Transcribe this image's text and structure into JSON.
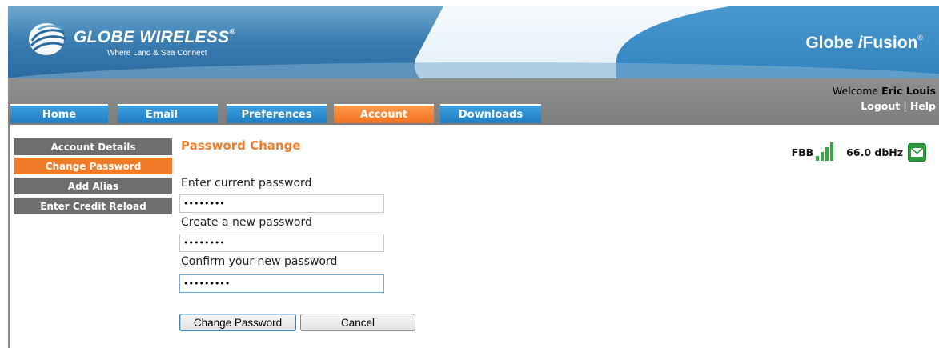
{
  "header": {
    "logo_text": "GLOBE WIRELESS",
    "logo_reg": "®",
    "tagline": "Where Land & Sea Connect",
    "product_pre": "Globe ",
    "product_i": "i",
    "product_post": "Fusion",
    "product_reg": "®"
  },
  "nav": {
    "tabs": [
      {
        "label": "Home",
        "active": false
      },
      {
        "label": "Email",
        "active": false
      },
      {
        "label": "Preferences",
        "active": false
      },
      {
        "label": "Account",
        "active": true
      },
      {
        "label": "Downloads",
        "active": false
      }
    ],
    "welcome_prefix": "Welcome ",
    "user_name": "Eric Louis",
    "logout_label": "Logout",
    "separator": "|",
    "help_label": "Help"
  },
  "sidebar": {
    "items": [
      {
        "label": "Account Details",
        "active": false
      },
      {
        "label": "Change Password",
        "active": true
      },
      {
        "label": "Add Alias",
        "active": false
      },
      {
        "label": "Enter Credit Reload",
        "active": false
      }
    ]
  },
  "form": {
    "title": "Password Change",
    "current_label": "Enter current password",
    "current_value": "password",
    "new_label": "Create a new password",
    "new_value": "password",
    "confirm_label": "Confirm your new password",
    "confirm_value": "password1",
    "change_button": "Change Password",
    "cancel_button": "Cancel"
  },
  "status": {
    "connection": "FBB",
    "signal": "66.0 dbHz",
    "signal_icon": "signal-bars-icon",
    "mail_icon": "mail-envelope-icon"
  },
  "colors": {
    "accent_orange": "#f27b2a",
    "tab_blue": "#1f7cc2",
    "menu_gray": "#6e6e6e",
    "signal_green": "#3aa845"
  }
}
